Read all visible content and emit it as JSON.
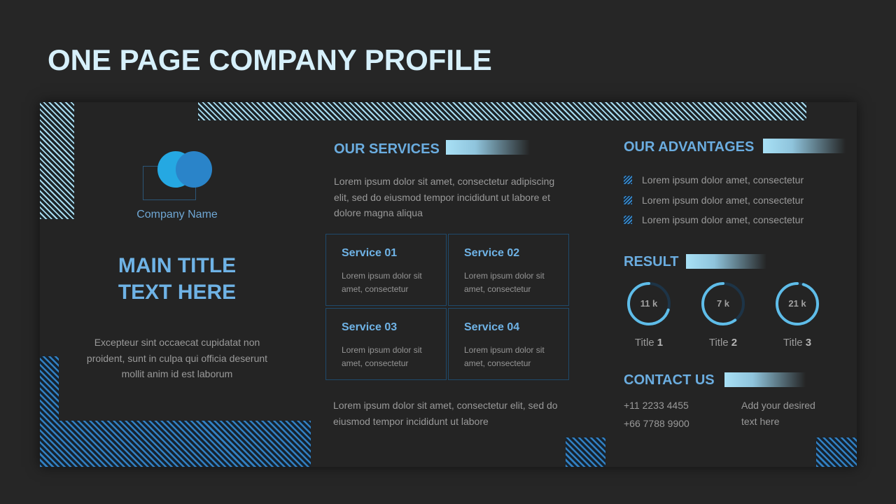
{
  "page": {
    "title": "ONE PAGE COMPANY PROFILE"
  },
  "left": {
    "company_name": "Company Name",
    "main_title_line1": "MAIN TITLE",
    "main_title_line2": "TEXT HERE",
    "description": "Excepteur sint occaecat cupidatat non proident, sunt in culpa qui officia deserunt mollit anim id est laborum"
  },
  "services": {
    "heading": "OUR SERVICES",
    "intro": "Lorem ipsum dolor sit amet, consectetur adipiscing elit, sed do eiusmod tempor incididunt ut labore et dolore magna aliqua",
    "items": [
      {
        "title": "Service 01",
        "text": "Lorem ipsum dolor sit amet, consectetur"
      },
      {
        "title": "Service 02",
        "text": "Lorem ipsum dolor sit amet, consectetur"
      },
      {
        "title": "Service 03",
        "text": "Lorem ipsum dolor sit amet, consectetur"
      },
      {
        "title": "Service 04",
        "text": "Lorem ipsum dolor sit amet, consectetur"
      }
    ],
    "footer": "Lorem ipsum dolor sit amet, consectetur elit, sed do eiusmod tempor incididunt ut labore"
  },
  "advantages": {
    "heading": "OUR ADVANTAGES",
    "icon": "striped-square-bullet-icon",
    "items": [
      "Lorem ipsum dolor amet, consectetur",
      "Lorem ipsum dolor amet, consectetur",
      "Lorem ipsum dolor amet, consectetur"
    ]
  },
  "result": {
    "heading": "RESULT",
    "items": [
      {
        "value": "11 k",
        "label": "Title",
        "num": "1",
        "progress": 0.7
      },
      {
        "value": "7 k",
        "label": "Title",
        "num": "2",
        "progress": 0.6
      },
      {
        "value": "21 k",
        "label": "Title",
        "num": "3",
        "progress": 0.95
      }
    ]
  },
  "contact": {
    "heading": "CONTACT US",
    "phones": [
      "+11 2233 4455",
      "+66 7788 9900"
    ],
    "note": "Add your desired text here"
  },
  "colors": {
    "background": "#262626",
    "panel": "#242424",
    "accent": "#6bade0",
    "accent_light": "#a8e0f5",
    "ring_fill": "#5fbde9",
    "ring_track": "#1d3447",
    "title": "#d6f0fb"
  }
}
